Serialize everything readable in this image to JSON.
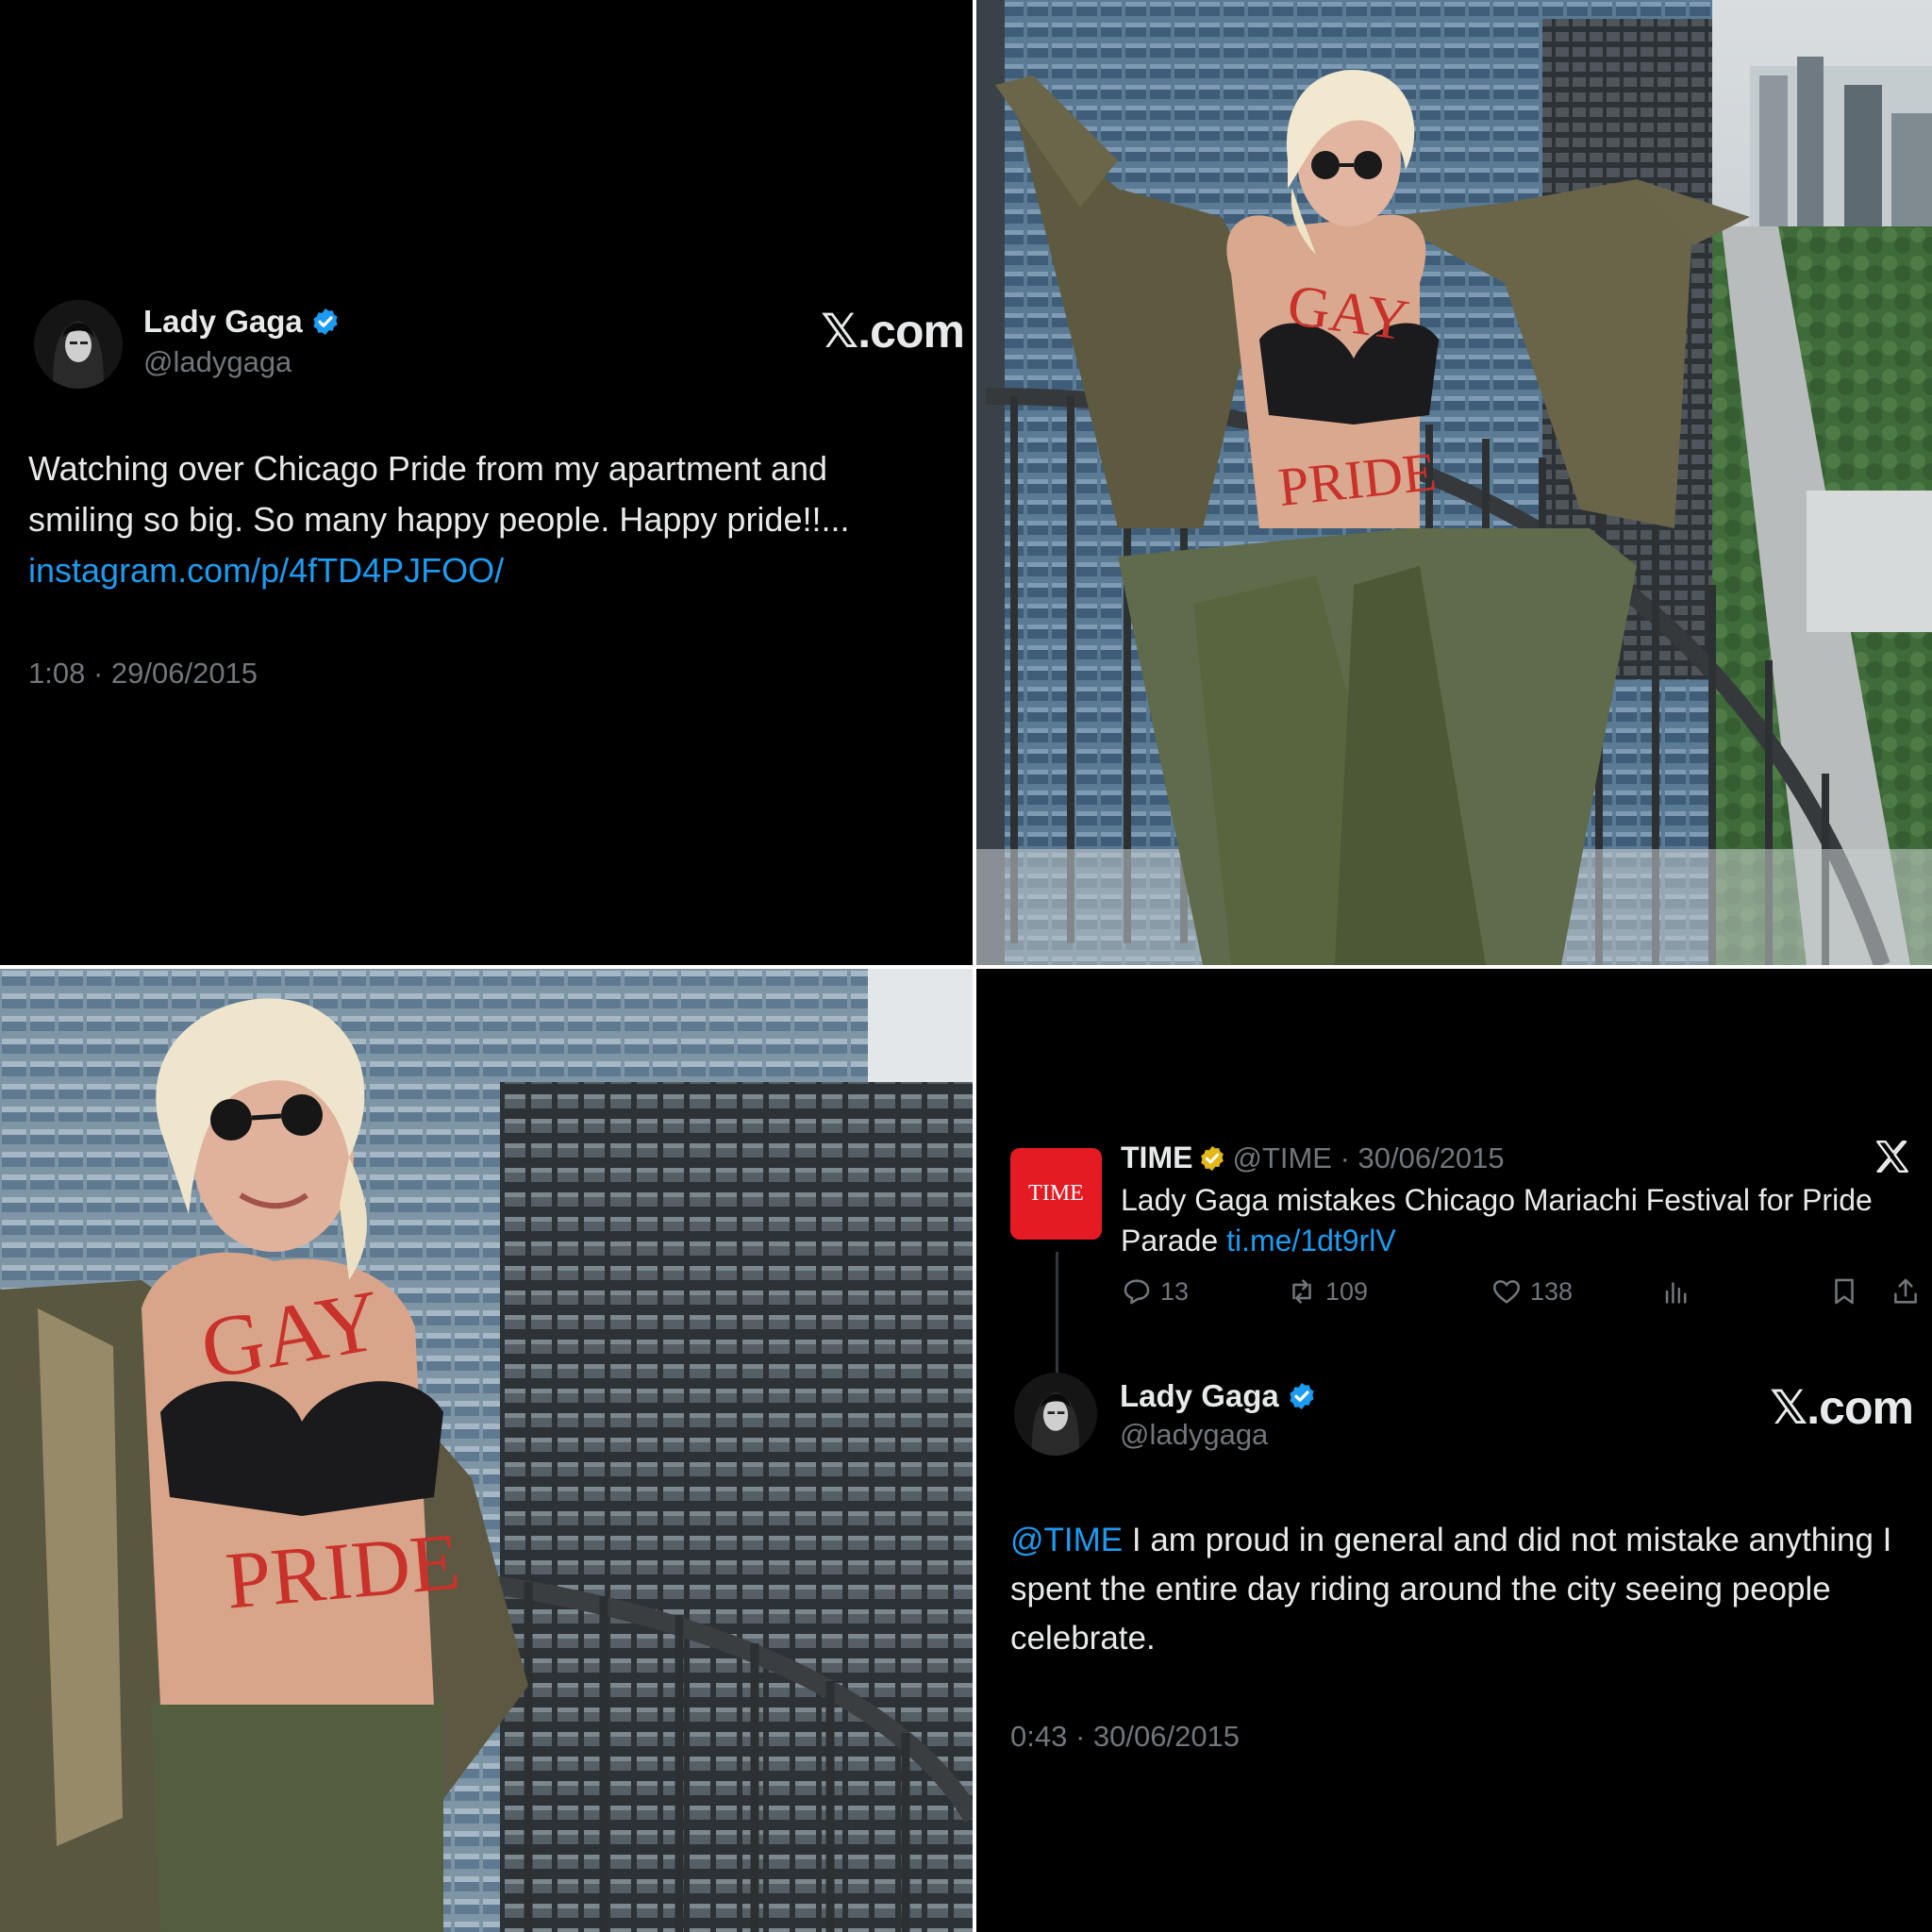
{
  "tweet1": {
    "name": "Lady Gaga",
    "handle": "@ladygaga",
    "brand": "𝕏.com",
    "text": "Watching over Chicago Pride from my apartment and smiling so big. So many happy people. Happy pride!!...",
    "link": "instagram.com/p/4fTD4PJFOO/",
    "timestamp": "1:08 · 29/06/2015"
  },
  "photo_top": {
    "body_text_chest": "GAY",
    "body_text_belly": "PRIDE"
  },
  "photo_bottom": {
    "body_text_chest": "GAY",
    "body_text_belly": "PRIDE"
  },
  "time_tweet": {
    "logo": "TIME",
    "name": "TIME",
    "handle_date": "@TIME · 30/06/2015",
    "text": "Lady Gaga mistakes Chicago Mariachi Festival for Pride Parade",
    "link": "ti.me/1dt9rlV",
    "replies": "13",
    "retweets": "109",
    "likes": "138"
  },
  "reply_tweet": {
    "name": "Lady Gaga",
    "handle": "@ladygaga",
    "brand": "𝕏.com",
    "mention": "@TIME",
    "text": "I am proud in general and did not mistake anything I spent the entire day riding around the city seeing people celebrate.",
    "timestamp": "0:43 · 30/06/2015"
  },
  "colors": {
    "background": "#000000",
    "text": "#e7e9ea",
    "muted": "#71767b",
    "link": "#1d9bf0",
    "verified_blue": "#1d9bf0",
    "verified_gold": "#e2b719",
    "time_red": "#e51b23",
    "body_writing": "#c8322b"
  },
  "icons": [
    "verified-badge-icon",
    "gold-verified-badge-icon",
    "x-logo-icon",
    "reply-icon",
    "retweet-icon",
    "like-icon",
    "views-icon",
    "bookmark-icon",
    "share-icon"
  ]
}
